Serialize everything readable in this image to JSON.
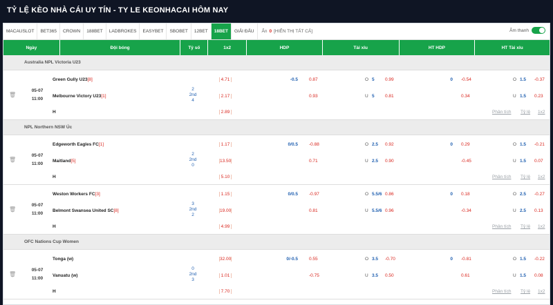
{
  "page_title": "TỶ LỆ KÈO NHÀ CÁI UY TÍN - TY LE KEONHACAI HÔM NAY",
  "tabs": [
    "MACAUSLOT",
    "BET365",
    "CROWN",
    "188BET",
    "LADBROKES",
    "EASYBET",
    "SBOBET",
    "12BET",
    "18BET",
    "GIẢI ĐẤU"
  ],
  "active_tab": "18BET",
  "hide": {
    "prefix": "Ẩn",
    "count": "0",
    "suffix": "[HIỂN THỊ TẤT CẢ]"
  },
  "sound": {
    "label": "Âm thanh",
    "on": true
  },
  "headers": {
    "date": "Ngày",
    "teams": "Đội bóng",
    "score": "Tỷ số",
    "x12": "1x2",
    "hdp": "HDP",
    "tx": "Tài xỉu",
    "ht_hdp": "HT HDP",
    "ht_tx": "HT Tài xỉu"
  },
  "links": {
    "analysis": "Phân tích",
    "ratio": "Tỷ lệ",
    "x12": "1x2"
  },
  "leagues": [
    {
      "name": "Australia NPL Victoria U23",
      "matches": [
        {
          "date": "05-07",
          "time": "11:00",
          "home": "Green Gully U23",
          "home_rank": "[8]",
          "away": "Melbourne Victory U23",
          "away_rank": "[1]",
          "score_home": "2",
          "half": "2nd",
          "score_away": "4",
          "odds_1x2": [
            "4.71",
            "2.17",
            "2.89"
          ],
          "draw_label": "H",
          "hdp_line": "-0.5",
          "hdp_home": "0.87",
          "hdp_away": "0.93",
          "tx_o_label": "O",
          "tx_line_o": "5",
          "tx_o": "0.99",
          "tx_u_label": "U",
          "tx_line_u": "5",
          "tx_u": "0.81",
          "ht_hdp_line": "0",
          "ht_hdp_home": "-0.54",
          "ht_hdp_away": "0.34",
          "ht_tx_o_label": "O",
          "ht_tx_line_o": "1.5",
          "ht_tx_o": "-0.37",
          "ht_tx_u_label": "U",
          "ht_tx_line_u": "1.5",
          "ht_tx_u": "0.23"
        }
      ]
    },
    {
      "name": "NPL Northern NSW Úc",
      "matches": [
        {
          "date": "05-07",
          "time": "11:00",
          "home": "Edgeworth Eagles FC",
          "home_rank": "[1]",
          "away": "Maitland",
          "away_rank": "[5]",
          "score_home": "2",
          "half": "2nd",
          "score_away": "0",
          "odds_1x2": [
            "1.17",
            "13.50",
            "5.10"
          ],
          "draw_label": "H",
          "hdp_line": "0/0.5",
          "hdp_home": "-0.88",
          "hdp_away": "0.71",
          "tx_o_label": "O",
          "tx_line_o": "2.5",
          "tx_o": "0.92",
          "tx_u_label": "U",
          "tx_line_u": "2.5",
          "tx_u": "0.90",
          "ht_hdp_line": "0",
          "ht_hdp_home": "0.29",
          "ht_hdp_away": "-0.45",
          "ht_tx_o_label": "O",
          "ht_tx_line_o": "1.5",
          "ht_tx_o": "-0.21",
          "ht_tx_u_label": "U",
          "ht_tx_line_u": "1.5",
          "ht_tx_u": "0.07"
        },
        {
          "date": "05-07",
          "time": "11:00",
          "home": "Weston Workers FC",
          "home_rank": "[3]",
          "away": "Belmont Swansea United SC",
          "away_rank": "[8]",
          "score_home": "3",
          "half": "2nd",
          "score_away": "2",
          "odds_1x2": [
            "1.15",
            "19.00",
            "4.99"
          ],
          "draw_label": "H",
          "hdp_line": "0/0.5",
          "hdp_home": "-0.97",
          "hdp_away": "0.81",
          "tx_o_label": "O",
          "tx_line_o": "5.5/6",
          "tx_o": "0.86",
          "tx_u_label": "U",
          "tx_line_u": "5.5/6",
          "tx_u": "0.96",
          "ht_hdp_line": "0",
          "ht_hdp_home": "0.18",
          "ht_hdp_away": "-0.34",
          "ht_tx_o_label": "O",
          "ht_tx_line_o": "2.5",
          "ht_tx_o": "-0.27",
          "ht_tx_u_label": "U",
          "ht_tx_line_u": "2.5",
          "ht_tx_u": "0.13"
        }
      ]
    },
    {
      "name": "OFC Nations Cup Women",
      "matches": [
        {
          "date": "05-07",
          "time": "11:00",
          "home": "Tonga (w)",
          "home_rank": "",
          "away": "Vanuatu (w)",
          "away_rank": "",
          "score_home": "0",
          "half": "2nd",
          "score_away": "3",
          "odds_1x2": [
            "32.00",
            "1.01",
            "7.70"
          ],
          "draw_label": "H",
          "hdp_line": "0/-0.5",
          "hdp_home": "0.55",
          "hdp_away": "-0.75",
          "tx_o_label": "O",
          "tx_line_o": "3.5",
          "tx_o": "-0.70",
          "tx_u_label": "U",
          "tx_line_u": "3.5",
          "tx_u": "0.50",
          "ht_hdp_line": "0",
          "ht_hdp_home": "-0.81",
          "ht_hdp_away": "0.61",
          "ht_tx_o_label": "O",
          "ht_tx_line_o": "1.5",
          "ht_tx_o": "-0.22",
          "ht_tx_u_label": "U",
          "ht_tx_line_u": "1.5",
          "ht_tx_u": "0.08"
        }
      ]
    }
  ],
  "colors": {
    "header_green": "#17a34a",
    "accent_red": "#d9251d",
    "accent_blue": "#1f5fb0"
  }
}
